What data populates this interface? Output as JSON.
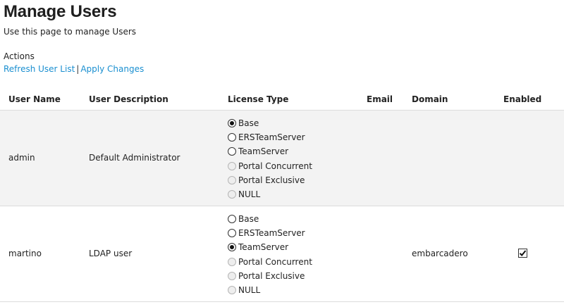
{
  "header": {
    "title": "Manage Users",
    "subtitle": "Use this page to manage Users"
  },
  "actions": {
    "label": "Actions",
    "refresh_label": "Refresh User List",
    "separator": "|",
    "apply_label": "Apply Changes"
  },
  "table": {
    "columns": [
      "User Name",
      "User Description",
      "License Type",
      "Email",
      "Domain",
      "Enabled"
    ],
    "rows": [
      {
        "user_name": "admin",
        "description": "Default Administrator",
        "email": "",
        "domain": "",
        "enabled": null,
        "license_options": [
          {
            "label": "Base",
            "checked": true,
            "disabled": false
          },
          {
            "label": "ERSTeamServer",
            "checked": false,
            "disabled": false
          },
          {
            "label": "TeamServer",
            "checked": false,
            "disabled": false
          },
          {
            "label": "Portal Concurrent",
            "checked": false,
            "disabled": true
          },
          {
            "label": "Portal Exclusive",
            "checked": false,
            "disabled": true
          },
          {
            "label": "NULL",
            "checked": false,
            "disabled": true
          }
        ]
      },
      {
        "user_name": "martino",
        "description": "LDAP user",
        "email": "",
        "domain": "embarcadero",
        "enabled": true,
        "license_options": [
          {
            "label": "Base",
            "checked": false,
            "disabled": false
          },
          {
            "label": "ERSTeamServer",
            "checked": false,
            "disabled": false
          },
          {
            "label": "TeamServer",
            "checked": true,
            "disabled": false
          },
          {
            "label": "Portal Concurrent",
            "checked": false,
            "disabled": true
          },
          {
            "label": "Portal Exclusive",
            "checked": false,
            "disabled": true
          },
          {
            "label": "NULL",
            "checked": false,
            "disabled": true
          }
        ]
      }
    ]
  }
}
